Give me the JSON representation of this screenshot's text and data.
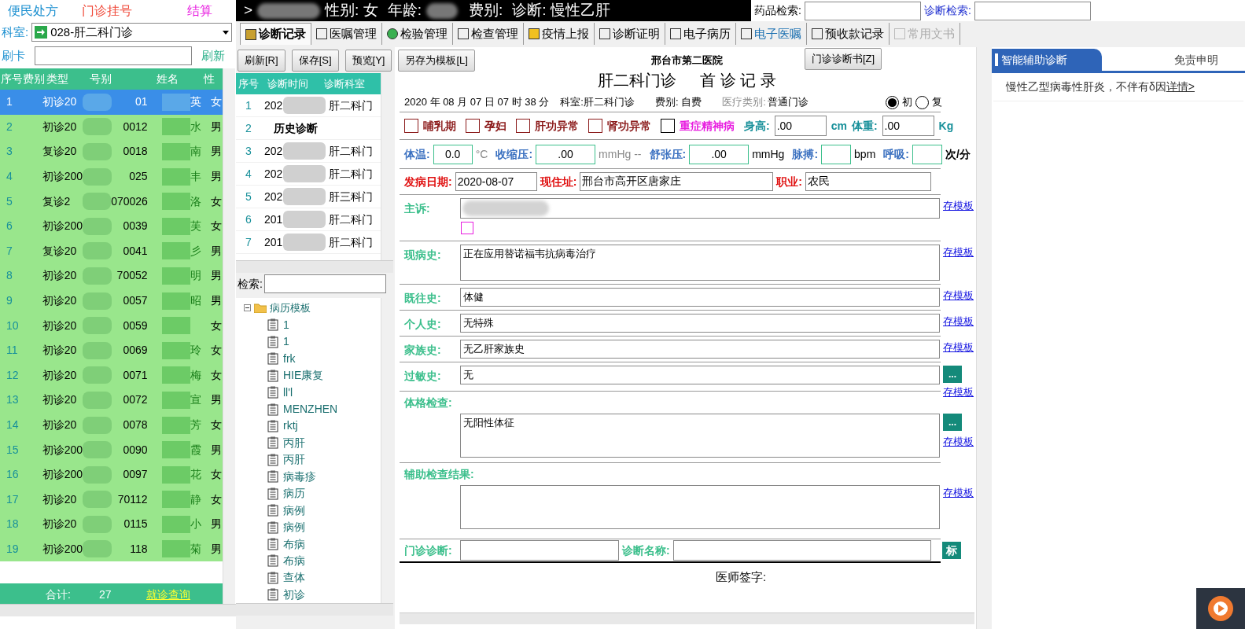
{
  "top_links": [
    {
      "label": "便民处方",
      "color": "#1a8fd0"
    },
    {
      "label": "门诊挂号",
      "color": "#f04a3a"
    },
    {
      "label": "结算",
      "color": "#e81ee0"
    }
  ],
  "department": {
    "label": "科室:",
    "value": "028-肝二科门诊"
  },
  "card": {
    "label": "刷卡",
    "refresh": "刷新"
  },
  "patients": {
    "columns": [
      "序号",
      "费别",
      "类型",
      "号别",
      "姓名",
      "性"
    ],
    "rows": [
      {
        "index": "1",
        "type": "初诊20",
        "number": "01",
        "name": "英",
        "sex": "女",
        "selected": true
      },
      {
        "index": "2",
        "type": "初诊20",
        "number": "0012",
        "name": "水",
        "sex": "男",
        "selected": false
      },
      {
        "index": "3",
        "type": "复诊20",
        "number": "0018",
        "name": "南",
        "sex": "男",
        "selected": false
      },
      {
        "index": "4",
        "type": "初诊200",
        "number": "025",
        "name": "丰",
        "sex": "男",
        "selected": false
      },
      {
        "index": "5",
        "type": "复诊2",
        "number": "070026",
        "name": "洛",
        "sex": "女",
        "selected": false
      },
      {
        "index": "6",
        "type": "初诊200",
        "number": "0039",
        "name": "芙",
        "sex": "女",
        "selected": false
      },
      {
        "index": "7",
        "type": "复诊20",
        "number": "0041",
        "name": "彡",
        "sex": "男",
        "selected": false
      },
      {
        "index": "8",
        "type": "初诊20",
        "number": "70052",
        "name": "明",
        "sex": "男",
        "selected": false
      },
      {
        "index": "9",
        "type": "初诊20",
        "number": "0057",
        "name": "昭",
        "sex": "男",
        "selected": false
      },
      {
        "index": "10",
        "type": "初诊20",
        "number": "0059",
        "sex": "女",
        "selected": false
      },
      {
        "index": "11",
        "type": "初诊20",
        "number": "0069",
        "name": "玲",
        "sex": "女",
        "selected": false
      },
      {
        "index": "12",
        "type": "初诊20",
        "number": "0071",
        "name": "梅",
        "sex": "女",
        "selected": false
      },
      {
        "index": "13",
        "type": "初诊20",
        "number": "0072",
        "name": "宣",
        "sex": "男",
        "selected": false
      },
      {
        "index": "14",
        "type": "初诊20",
        "number": "0078",
        "name": "芳",
        "sex": "女",
        "selected": false
      },
      {
        "index": "15",
        "type": "初诊200",
        "number": "0090",
        "name": "霞",
        "sex": "男",
        "selected": false
      },
      {
        "index": "16",
        "type": "初诊200",
        "number": "0097",
        "name": "花",
        "sex": "女",
        "selected": false
      },
      {
        "index": "17",
        "type": "初诊20",
        "number": "70112",
        "name": "静",
        "sex": "女",
        "selected": false
      },
      {
        "index": "18",
        "type": "初诊20",
        "number": "0115",
        "name": "小",
        "sex": "男",
        "selected": false
      },
      {
        "index": "19",
        "type": "初诊200",
        "number": "118",
        "name": "菊",
        "sex": "男",
        "selected": false
      }
    ]
  },
  "footer": {
    "label": "合计:",
    "count": "27",
    "link": "就诊查询"
  },
  "patient_bar": {
    "prefix": ">",
    "gender_label": "性别:",
    "gender": "女",
    "age_label": "年龄:",
    "fee_label": "费别:",
    "diagnosis_label": "诊断:",
    "diagnosis": "慢性乙肝"
  },
  "searches": [
    {
      "label": "药品检索:"
    },
    {
      "label": "诊断检索:"
    }
  ],
  "tabs": [
    {
      "label": "诊断记录",
      "selected": true,
      "disabled": false
    },
    {
      "label": "医嘱管理",
      "selected": false,
      "disabled": false
    },
    {
      "label": "检验管理",
      "selected": false,
      "disabled": false
    },
    {
      "label": "检查管理",
      "selected": false,
      "disabled": false
    },
    {
      "label": "疫情上报",
      "selected": false,
      "disabled": false
    },
    {
      "label": "诊断证明",
      "selected": false,
      "disabled": false
    },
    {
      "label": "电子病历",
      "selected": false,
      "disabled": false
    },
    {
      "label": "电子医嘱",
      "selected": false,
      "disabled": false
    },
    {
      "label": "预收款记录",
      "selected": false,
      "disabled": false
    },
    {
      "label": "常用文书",
      "selected": false,
      "disabled": true
    }
  ],
  "toolbar": [
    "刷新[R]",
    "保存[S]",
    "预览[Y]",
    "另存为模板[L]"
  ],
  "certificate_button": "门诊诊断书[Z]",
  "history": {
    "columns": [
      "序号",
      "诊断时间",
      "诊断科室"
    ],
    "rows": [
      {
        "kind": "record",
        "index": "1",
        "date": "202",
        "dept": "肝二科门"
      },
      {
        "kind": "heading",
        "index": "2",
        "label": "历史诊断"
      },
      {
        "kind": "record",
        "index": "3",
        "date": "202",
        "dept": "肝二科门"
      },
      {
        "kind": "record",
        "index": "4",
        "date": "202",
        "dept": "肝二科门"
      },
      {
        "kind": "record",
        "index": "5",
        "date": "202",
        "dept": "肝三科门"
      },
      {
        "kind": "record",
        "index": "6",
        "date": "201",
        "dept": "肝二科门"
      },
      {
        "kind": "record",
        "index": "7",
        "date": "201",
        "dept": "肝二科门"
      }
    ]
  },
  "template_search": {
    "label": "检索:"
  },
  "template_tree": {
    "label": "病历模板",
    "expanded": true,
    "children": [
      {
        "label": "1"
      },
      {
        "label": "1"
      },
      {
        "label": "frk"
      },
      {
        "label": "HIE康复"
      },
      {
        "label": "ll'l"
      },
      {
        "label": "MENZHEN"
      },
      {
        "label": "rktj"
      },
      {
        "label": "丙肝"
      },
      {
        "label": "丙肝"
      },
      {
        "label": "病毒疹"
      },
      {
        "label": "病历"
      },
      {
        "label": "病例"
      },
      {
        "label": "病例"
      },
      {
        "label": "布病"
      },
      {
        "label": "布病"
      },
      {
        "label": "查体"
      },
      {
        "label": "初诊"
      }
    ]
  },
  "record": {
    "hospital": "邢台市第二医院",
    "title": "肝二科门诊",
    "subtitle": "首 诊 记 录",
    "visit_time": "2020 年 08 月 07 日 07 时 38 分",
    "department": "科室:肝二科门诊",
    "fee": "费别: 自费",
    "category_label": "医疗类别:",
    "category": "普通门诊",
    "visit_types": [
      {
        "label": "初",
        "selected": true
      },
      {
        "label": "复",
        "selected": false
      }
    ],
    "flags": [
      {
        "label": "哺乳期",
        "checked": false,
        "color": "#8b1a1a"
      },
      {
        "label": "孕妇",
        "checked": false,
        "color": "#8b1a1a"
      },
      {
        "label": "肝功异常",
        "checked": false,
        "color": "#8b1a1a"
      },
      {
        "label": "肾功异常",
        "checked": false,
        "color": "#8b1a1a"
      },
      {
        "label": "重症精神病",
        "checked": false,
        "color": "#e81ee0"
      }
    ],
    "height": {
      "label": "身高:",
      "value": ".00",
      "unit": "cm"
    },
    "weight": {
      "label": "体重:",
      "value": ".00",
      "unit": "Kg"
    },
    "vitals": [
      {
        "label": "体温:",
        "value": "0.0",
        "unit": "°C"
      },
      {
        "label": "收缩压:",
        "value": ".00",
        "unit": "mmHg --"
      },
      {
        "label": "舒张压:",
        "value": ".00",
        "unit": "mmHg"
      },
      {
        "label": "脉搏:",
        "unit": "bpm"
      },
      {
        "label": "呼吸:",
        "unit": "次/分"
      }
    ],
    "onset": [
      {
        "label": "发病日期:",
        "value": "2020-08-07"
      },
      {
        "label": "现住址:",
        "value": "邢台市高开区唐家庄"
      },
      {
        "label": "职业:",
        "value": "农民"
      }
    ],
    "sections": [
      {
        "kind": "chief",
        "label": "主诉:",
        "link": "存模板",
        "checked": false
      },
      {
        "kind": "area",
        "label": "现病史:",
        "value": "正在应用替诺福韦抗病毒治疗",
        "link": "存模板"
      },
      {
        "kind": "line",
        "label": "既往史:",
        "value": "体健",
        "link": "存模板"
      },
      {
        "kind": "line",
        "label": "个人史:",
        "value": "无特殊",
        "link": "存模板"
      },
      {
        "kind": "line",
        "label": "家族史:",
        "value": "无乙肝家族史",
        "link": "存模板"
      },
      {
        "kind": "picker",
        "label": "过敏史:",
        "value": "无",
        "button": "...",
        "link": "存模板"
      },
      {
        "kind": "block",
        "label": "体格检查:",
        "value": "无阳性体征",
        "button": "...",
        "link": "存模板"
      },
      {
        "kind": "block",
        "label": "辅助检查结果:",
        "link": "存模板"
      }
    ],
    "diagnosis": {
      "label": "门诊诊断:",
      "name_label": "诊断名称:",
      "button": "标"
    },
    "signature": "医师签字:"
  },
  "assistant": {
    "tabs": [
      {
        "label": "智能辅助诊断",
        "selected": true
      },
      {
        "label": "免责申明",
        "selected": false
      }
    ],
    "suggestion": "慢性乙型病毒性肝炎，不伴有δ因",
    "link": "详情>"
  }
}
